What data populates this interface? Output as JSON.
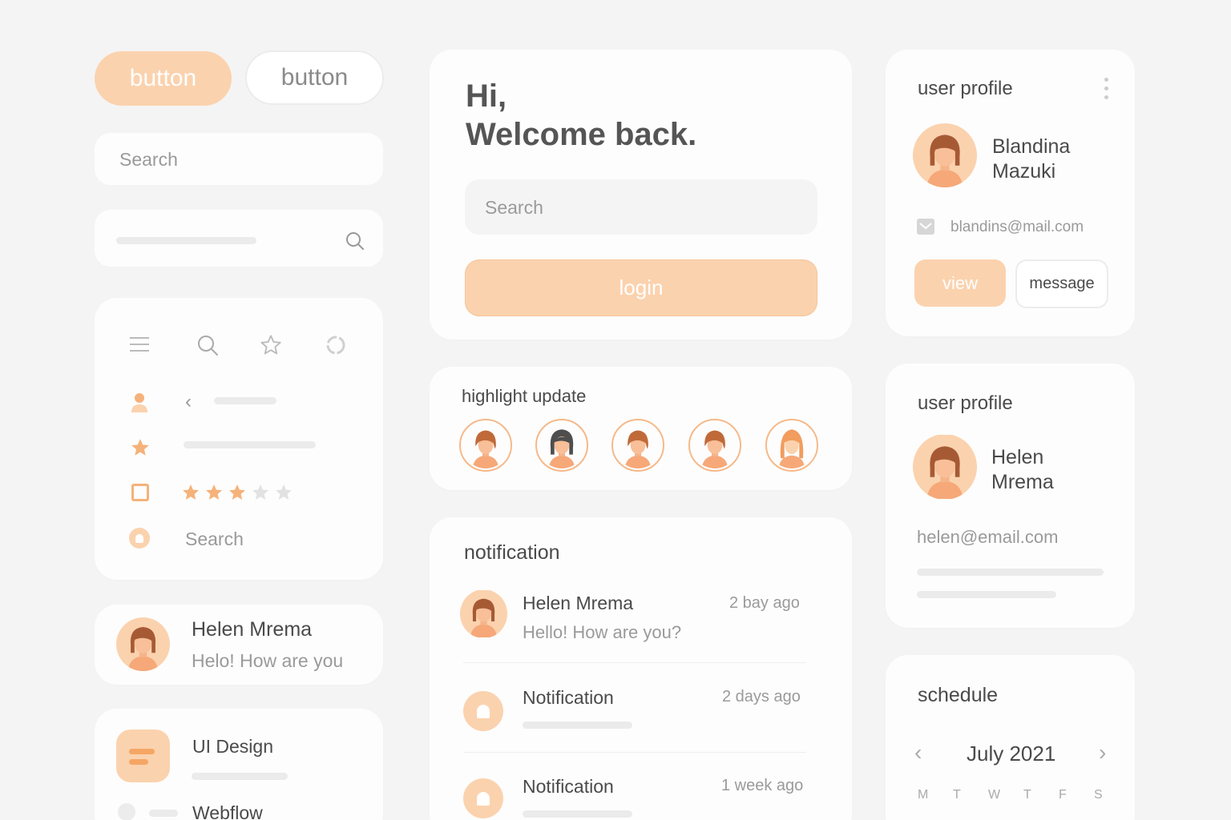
{
  "colors": {
    "accent": "#fbd2ae",
    "accent_text": "#ffffff",
    "background": "#f4f4f4",
    "card": "#fdfdfd",
    "star_on": "#f5b27a",
    "star_off": "#e2e2e2"
  },
  "left": {
    "primary_button": "button",
    "secondary_button": "button",
    "search_placeholder": "Search",
    "icon_panel": {
      "toolbar_icons": [
        "menu-icon",
        "search-icon",
        "star-icon",
        "loading-icon"
      ],
      "rating": 3,
      "rating_max": 5,
      "search_label": "Search"
    },
    "chat": {
      "name": "Helen Mrema",
      "message": "Helo! How are you"
    },
    "tasks": [
      {
        "label": "UI Design"
      },
      {
        "label": "Webflow"
      }
    ]
  },
  "welcome": {
    "line1": "Hi,",
    "line2": "Welcome back.",
    "search_placeholder": "Search",
    "login_label": "login"
  },
  "highlight": {
    "title": "highlight update",
    "avatars": [
      "avatar-1",
      "avatar-2",
      "avatar-3",
      "avatar-4",
      "avatar-5"
    ]
  },
  "notification": {
    "title": "notification",
    "items": [
      {
        "name": "Helen Mrema",
        "message": "Hello! How are you?",
        "time": "2 bay ago"
      },
      {
        "name": "Notification",
        "time": "2 days ago"
      },
      {
        "name": "Notification",
        "time": "1 week ago"
      }
    ]
  },
  "profile1": {
    "title": "user profile",
    "first_name": "Blandina",
    "last_name": "Mazuki",
    "email": "blandins@mail.com",
    "view_label": "view",
    "message_label": "message"
  },
  "profile2": {
    "title": "user profile",
    "first_name": "Helen",
    "last_name": "Mrema",
    "email": "helen@email.com"
  },
  "schedule": {
    "title": "schedule",
    "month": "July 2021",
    "days": [
      "M",
      "T",
      "W",
      "T",
      "F",
      "S"
    ]
  }
}
